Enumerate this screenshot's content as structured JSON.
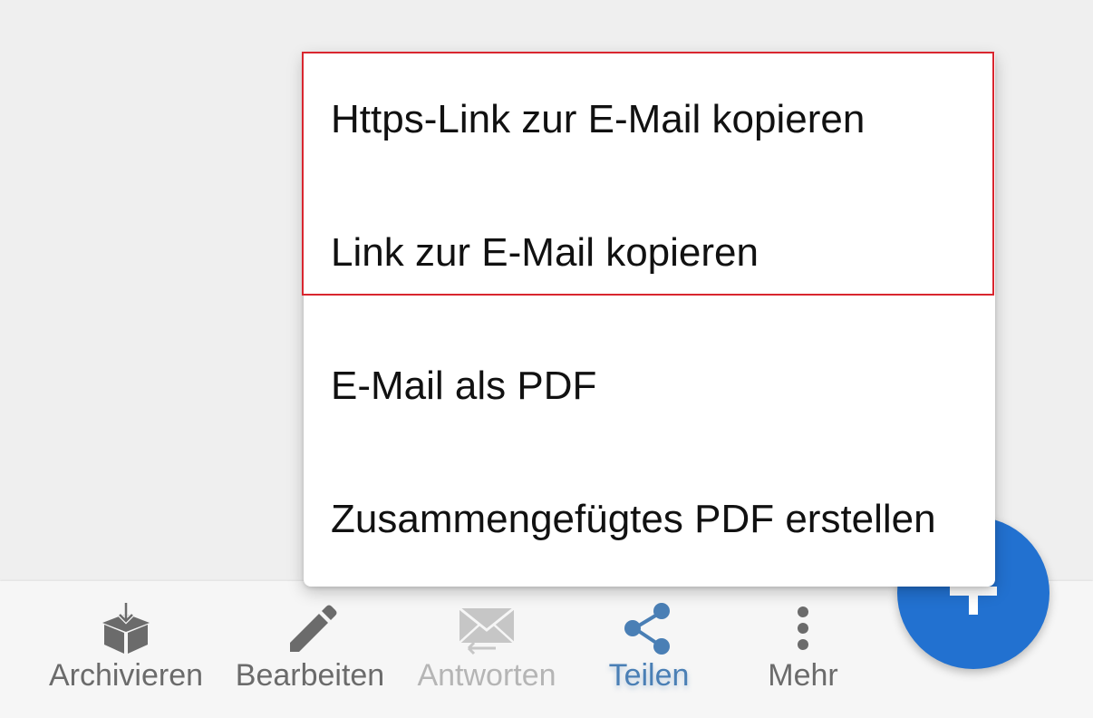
{
  "menu": {
    "items": [
      {
        "label": "Https-Link zur E-Mail kopieren"
      },
      {
        "label": "Link zur E-Mail kopieren"
      },
      {
        "label": "E-Mail als PDF"
      },
      {
        "label": "Zusammengefügtes PDF erstellen"
      }
    ]
  },
  "toolbar": {
    "items": [
      {
        "label": "Archivieren",
        "icon": "archive-box-icon",
        "state": "normal"
      },
      {
        "label": "Bearbeiten",
        "icon": "pencil-icon",
        "state": "normal"
      },
      {
        "label": "Antworten",
        "icon": "reply-mail-icon",
        "state": "disabled"
      },
      {
        "label": "Teilen",
        "icon": "share-icon",
        "state": "active"
      },
      {
        "label": "Mehr",
        "icon": "more-vertical-icon",
        "state": "normal"
      }
    ]
  },
  "fab": {
    "icon": "plus-icon"
  },
  "colors": {
    "accent": "#4a7fb5",
    "fab": "#2271d0",
    "highlight": "#d9262f",
    "icon": "#6b6b6b",
    "disabled": "#b5b5b5"
  }
}
